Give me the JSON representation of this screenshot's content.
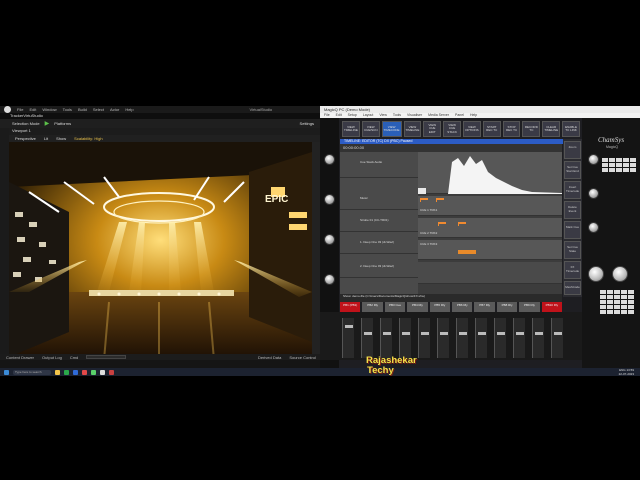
{
  "ue": {
    "menu": [
      "File",
      "Edit",
      "Window",
      "Tools",
      "Build",
      "Select",
      "Actor",
      "Help"
    ],
    "window_title": "VirtualStudio",
    "level_tab": "TrackerVirtuStudio",
    "toolbar": {
      "select_mode": "Selection Mode",
      "platforms": "Platforms",
      "settings": "Settings"
    },
    "viewport_tab": "Viewport 1",
    "viewport_bar": {
      "perspective": "Perspective",
      "lit": "Lit",
      "show": "Show",
      "scalability": "Scalability: High"
    },
    "stage_text": "EPIC",
    "status": {
      "content_drawer": "Content Drawer",
      "output_log": "Output Log",
      "cmd": "Cmd",
      "console_placeholder": "Enter Console Command",
      "derived": "Derived Data",
      "source": "Source Control"
    }
  },
  "mq": {
    "title": "MagicQ PC (Demo Mode)",
    "menu": [
      "File",
      "Edit",
      "Setup",
      "Layout",
      "View",
      "Tools",
      "Visualiser",
      "Media Server",
      "Panel",
      "Help"
    ],
    "top_buttons": [
      "VIEW TIMELINE",
      "VIEW CUE/SCN",
      "VIEW TIMECODE",
      "VIEW TIMELINE",
      "VIEW CUE EDIT",
      "VIEW CUE STACK",
      "VIEW OPTIONS",
      "START REC TC",
      "STOP REC TC",
      "RECORD TC",
      "CLEAR TIMELINE",
      "ENABLE TC LINK"
    ],
    "window_bar": "TIMELINE: EDITOR (TC) DX (PBC) Paused",
    "timecode": "00:00:00.00",
    "tracks": [
      "Cue Stack Audio",
      "Music",
      "Strobe 01 (CC-TR01)",
      "1. Deep One 03 (dt-Wavi)",
      "2. Deep One 03 (dt-Wavi)"
    ],
    "cue_labels": [
      "CUE 1 TRK1",
      "CUE 2 TRK2",
      "CUE 3 TRK3"
    ],
    "right_buttons": [
      "Zoom",
      "Set Cue Start End",
      "Insert Timecode",
      "Delete Event",
      "Mark Cue",
      "Set Cue State",
      "FX Timecode",
      "MeshCode"
    ],
    "status_line": "Show: demo-file (C:\\Users\\Documents\\MagicQ\\show\\FX.shw)",
    "playbacks": [
      "PB1 (PB1)",
      "PB2 Rly",
      "PB3 Cue",
      "PB4 Rly",
      "PB5 Rly",
      "PB6 Rly",
      "PB7 Rly",
      "PB8 Rly",
      "PB9 Rly",
      "PB10 Rly",
      "PB11 Rly",
      "PB12 Rly"
    ],
    "fader_levels": [
      0.8,
      0.6,
      0.6,
      0.6,
      0.6,
      0.6,
      0.6,
      0.6,
      0.6,
      0.6,
      0.6,
      0.6
    ],
    "console_brand": "ChamSys",
    "console_model": "MagicQ"
  },
  "taskbar": {
    "search_placeholder": "Type here to search",
    "time": "13:59",
    "date": "22-07-2023",
    "lang": "ENG"
  },
  "watermark": {
    "line1": "Rajashekar",
    "line2": "Techy"
  }
}
